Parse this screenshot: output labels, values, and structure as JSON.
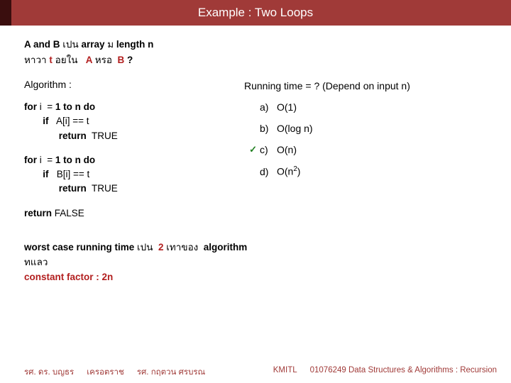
{
  "title": "Example : Two Loops",
  "problem": {
    "line1_prefix": "A and B ",
    "line1_thai1": "เปน ",
    "line1_array": "array ",
    "line1_thai2": "ม ",
    "line1_len": "length n",
    "line2_thai1": "หาวา ",
    "line2_t": "t ",
    "line2_thai2": "อยใน ",
    "line2_ab": "A ",
    "line2_thai3": "หรอ ",
    "line2_b": "B ",
    "line2_q": "?"
  },
  "algorithm": {
    "heading": "Algorithm :",
    "block1": "for i  = 1 to n do\n       if   A[i] == t\n             return  TRUE",
    "block2": "for i  = 1 to n do\n       if   B[i] == t\n             return  TRUE",
    "block3": "return FALSE"
  },
  "running_time": {
    "question": "Running time = ?  (Depend on input n)",
    "options": [
      {
        "label": "a)",
        "value": "O(1)",
        "checked": false
      },
      {
        "label": "b)",
        "value": "O(log n)",
        "checked": false
      },
      {
        "label": "c)",
        "value": "O(n)",
        "checked": true
      },
      {
        "label": "d)",
        "value": "O(n2)",
        "checked": false,
        "sup": "2"
      }
    ]
  },
  "worst_case": {
    "l1_a": "worst case running time ",
    "l1_b": "เปน ",
    "l1_c": "2 ",
    "l1_d": "เทาของ ",
    "l1_e": "algorithm",
    "l2": "ทแลว",
    "l3_a": "constant factor : ",
    "l3_b": "2n"
  },
  "footer": {
    "left1": "รศ. ดร. บญธร",
    "left2": "เครอตราช",
    "left3": "รศ. กฤตวน   ศรบรณ",
    "mid": "KMITL",
    "right": "01076249 Data Structures & Algorithms : Recursion"
  }
}
